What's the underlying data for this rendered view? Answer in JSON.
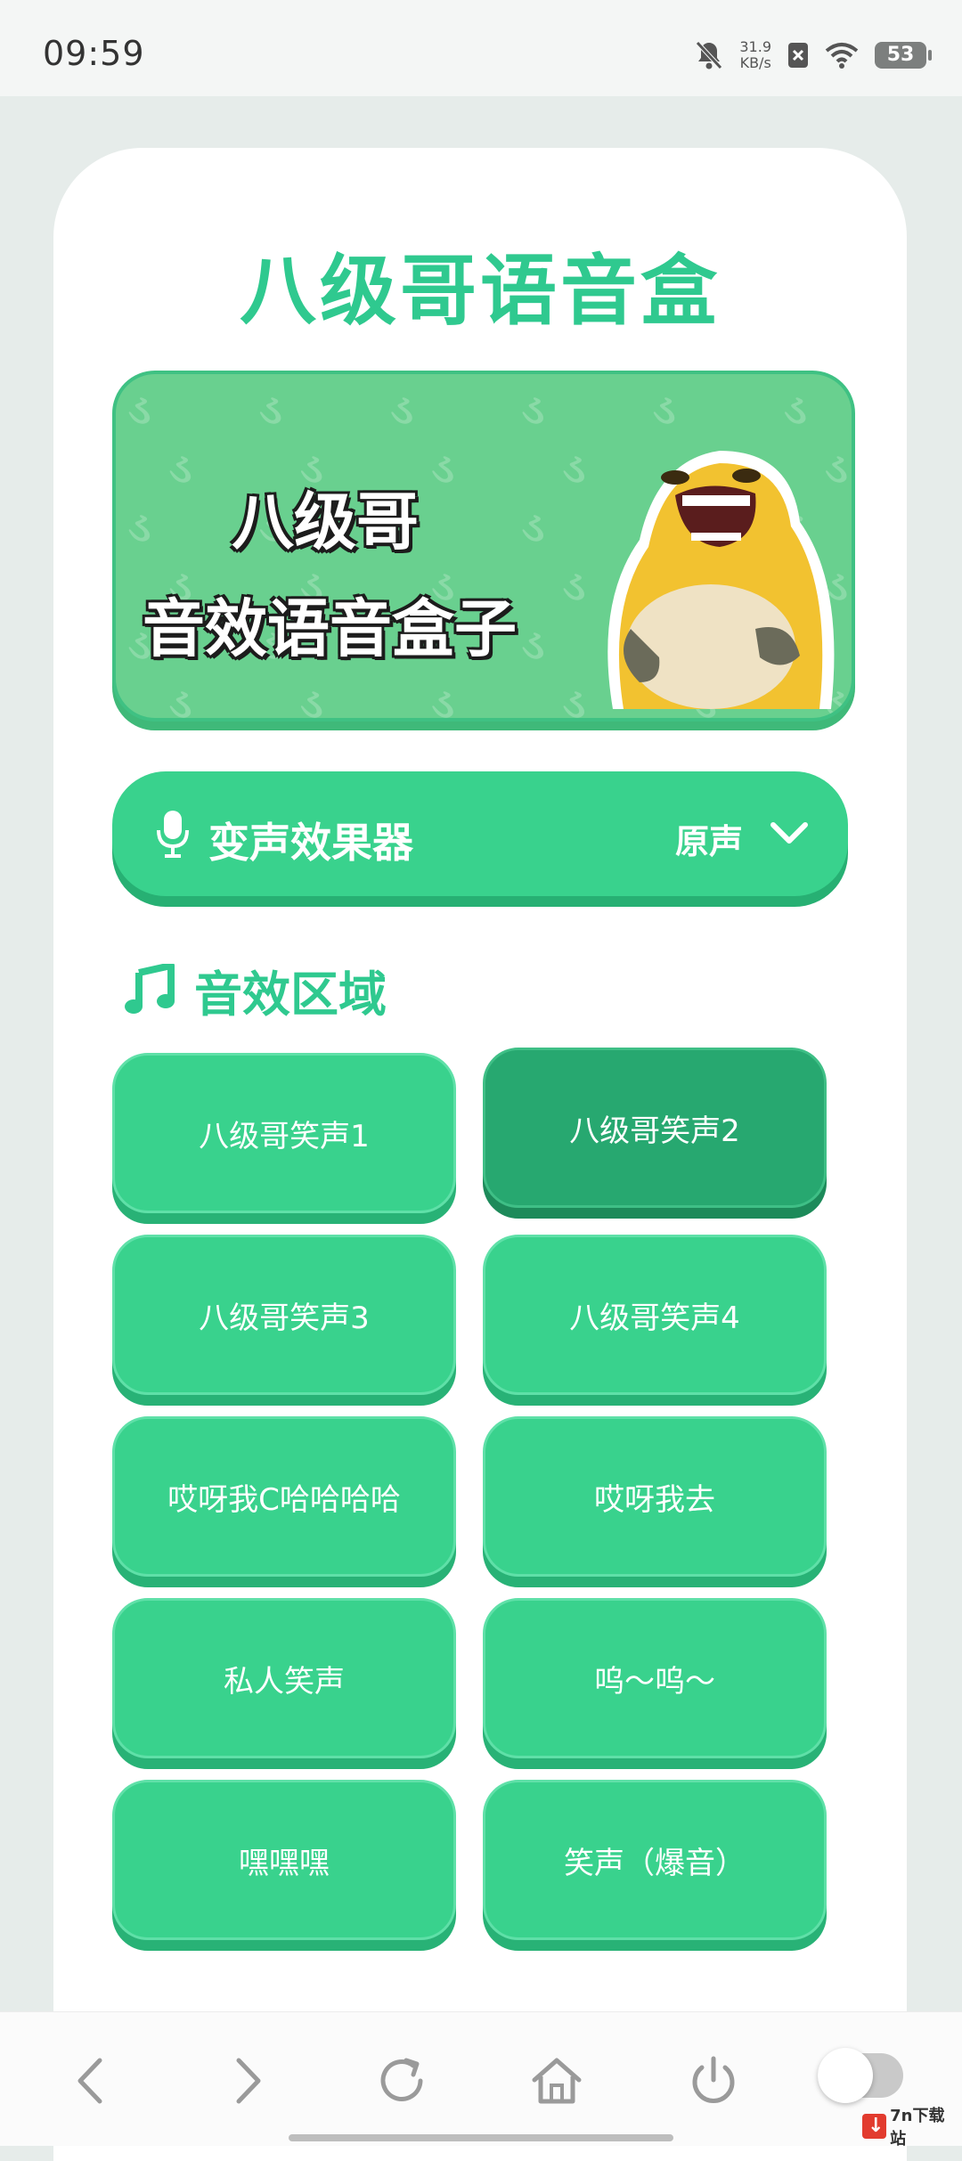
{
  "status": {
    "time": "09:59",
    "speed_value": "31.9",
    "speed_unit": "KB/s",
    "battery": "53"
  },
  "app": {
    "title": "八级哥语音盒"
  },
  "banner": {
    "line1": "八级哥",
    "line2": "音效语音盒子",
    "pattern": "ડ ડ ડ ડ ડ ડ ડ ડ ડ ડ ડ ડ"
  },
  "voice_changer": {
    "label": "变声效果器",
    "value": "原声"
  },
  "section": {
    "title": "音效区域"
  },
  "sounds": [
    "八级哥笑声1",
    "八级哥笑声2",
    "八级哥笑声3",
    "八级哥笑声4",
    "哎呀我C哈哈哈哈",
    "哎呀我去",
    "私人笑声",
    "呜～呜～",
    "嘿嘿嘿",
    "笑声（爆音）"
  ],
  "next_section_peek": "",
  "watermark": {
    "text": "7n下载站"
  },
  "colors": {
    "accent": "#39d28d",
    "accent_dark": "#27a870",
    "title": "#2fc98f"
  }
}
